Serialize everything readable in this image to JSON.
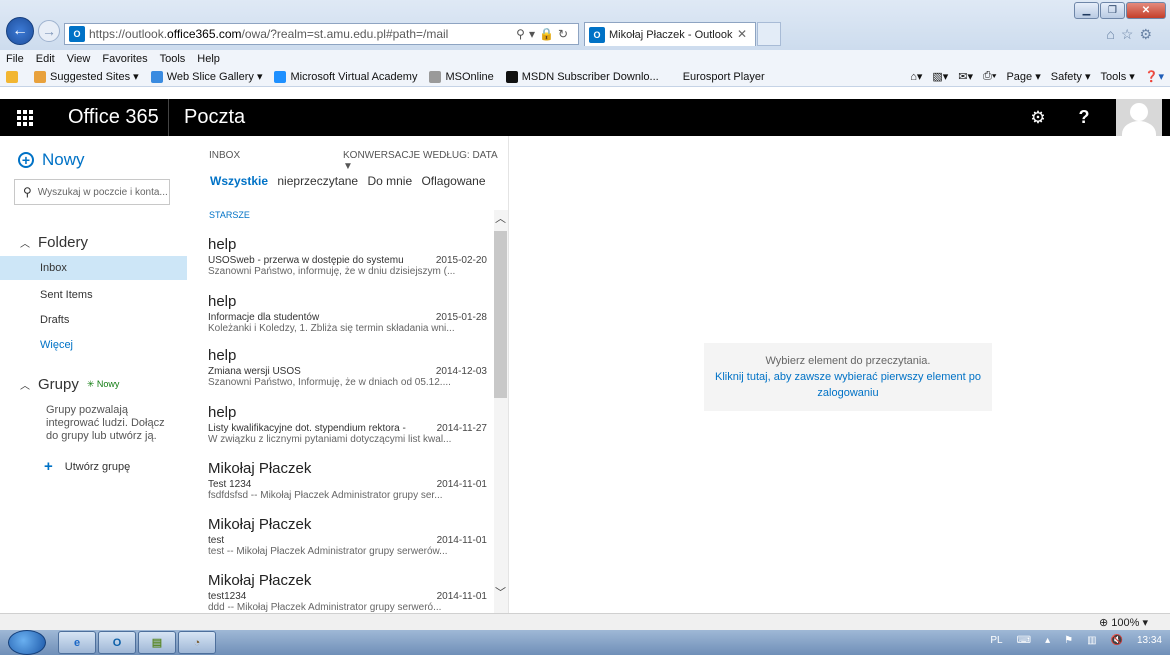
{
  "browser": {
    "address": {
      "prefix": "https://outlook.",
      "domain": "office365.com",
      "path": "/owa/?realm=st.amu.edu.pl#path=/mail"
    },
    "tab_title": "Mikołaj Płaczek - Outlook",
    "menu": [
      "File",
      "Edit",
      "View",
      "Favorites",
      "Tools",
      "Help"
    ],
    "favorites": [
      {
        "label": "Suggested Sites ▾",
        "color": "#e8a13c"
      },
      {
        "label": "Web Slice Gallery ▾",
        "color": "#3a8be0"
      },
      {
        "label": "Microsoft Virtual Academy",
        "color": "#1e90ff"
      },
      {
        "label": "MSOnline",
        "color": "#9a9a9a"
      },
      {
        "label": "MSDN Subscriber Downlo...",
        "color": "#111111"
      },
      {
        "label": "Eurosport Player",
        "color": ""
      }
    ],
    "command_bar": [
      "Page ▾",
      "Safety ▾",
      "Tools ▾"
    ],
    "zoom": "100%"
  },
  "suite": {
    "brand": "Office 365",
    "app": "Poczta"
  },
  "nav": {
    "new_label": "Nowy",
    "search_placeholder": "Wyszukaj w poczcie i konta...",
    "folders_label": "Foldery",
    "folders": [
      "Inbox",
      "Sent Items",
      "Drafts",
      "Więcej"
    ],
    "groups_label": "Grupy",
    "groups_new": "✳ Nowy",
    "groups_desc": "Grupy pozwalają integrować ludzi. Dołącz do grupy lub utwórz ją.",
    "create_group": "Utwórz grupę"
  },
  "list": {
    "folder": "INBOX",
    "sort": "KONWERSACJE WEDŁUG: DATA",
    "filters": [
      "Wszystkie",
      "nieprzeczytane",
      "Do mnie",
      "Oflagowane"
    ],
    "group": "STARSZE",
    "messages": [
      {
        "sender": "help",
        "subject": "USOSweb - przerwa w dostępie do systemu",
        "date": "2015-02-20",
        "preview": "Szanowni Państwo, informuję, że w dniu dzisiejszym (..."
      },
      {
        "sender": "help",
        "subject": "Informacje dla studentów",
        "date": "2015-01-28",
        "preview": "Koleżanki i Koledzy, 1. Zbliża się termin składania wni..."
      },
      {
        "sender": "help",
        "subject": "Zmiana wersji USOS",
        "date": "2014-12-03",
        "preview": "Szanowni Państwo, Informuję, że w dniach od 05.12...."
      },
      {
        "sender": "help",
        "subject": "Listy kwalifikacyjne dot. stypendium rektora - i",
        "date": "2014-11-27",
        "preview": "W związku z licznymi pytaniami dotyczącymi list kwal..."
      },
      {
        "sender": "Mikołaj Płaczek",
        "subject": "Test 1234",
        "date": "2014-11-01",
        "preview": "fsdfdsfsd -- Mikołaj Płaczek Administrator grupy ser..."
      },
      {
        "sender": "Mikołaj Płaczek",
        "subject": "test",
        "date": "2014-11-01",
        "preview": "test -- Mikołaj Płaczek Administrator grupy serwerów..."
      },
      {
        "sender": "Mikołaj Płaczek",
        "subject": "test1234",
        "date": "2014-11-01",
        "preview": "ddd -- Mikołaj Płaczek Administrator grupy serweró..."
      }
    ]
  },
  "reading": {
    "empty_message": "Wybierz element do przeczytania.",
    "link": "Kliknij tutaj, aby zawsze wybierać pierwszy element po zalogowaniu"
  },
  "taskbar": {
    "lang": "PL",
    "clock": "13:34"
  },
  "colors": {
    "accent": "#0072c6",
    "suitebar": "#000000",
    "selected_folder": "#cde6f7"
  }
}
